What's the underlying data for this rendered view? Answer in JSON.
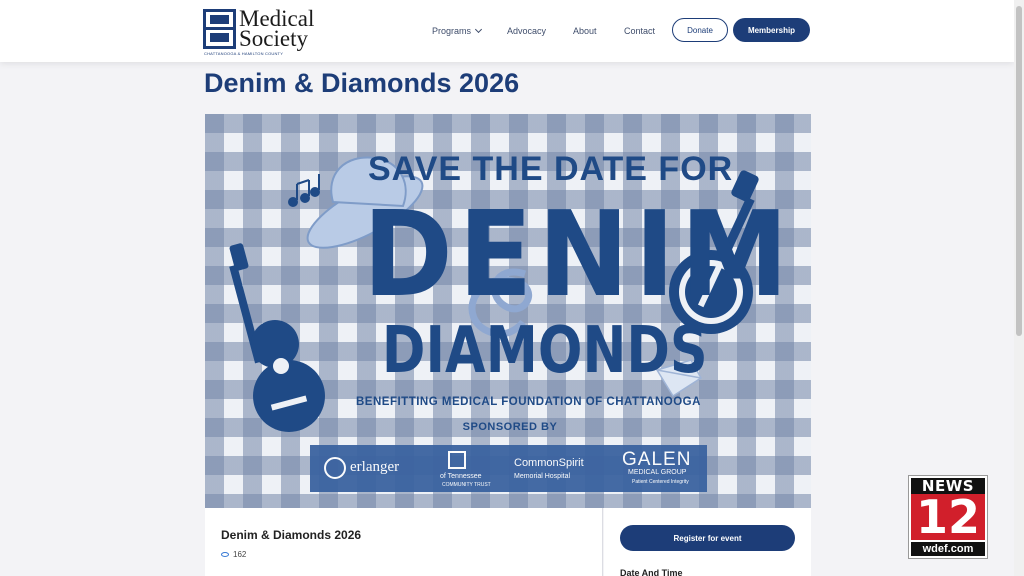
{
  "header": {
    "logo": {
      "line1": "Medical",
      "line2": "Society",
      "subtitle": "CHATTANOOGA & HAMILTON COUNTY"
    },
    "nav": {
      "programs": "Programs",
      "advocacy": "Advocacy",
      "about": "About",
      "contact": "Contact"
    },
    "donate_label": "Donate",
    "membership_label": "Membership"
  },
  "page": {
    "title": "Denim & Diamonds 2026"
  },
  "banner": {
    "save_the_date": "SAVE THE DATE FOR",
    "denim": "DENIM",
    "diamonds": "DIAMONDS",
    "benefitting": "BENEFITTING MEDICAL FOUNDATION OF CHATTANOOGA",
    "sponsored_by": "SPONSORED BY",
    "sponsors": {
      "erlanger": "erlanger",
      "bcbs_line1": "of Tennessee",
      "bcbs_line2": "COMMUNITY TRUST",
      "commonspirit_line1": "CommonSpirit",
      "commonspirit_line2": "Memorial Hospital",
      "galen_line1": "GALEN",
      "galen_line2": "MEDICAL GROUP",
      "galen_line3": "Patient Centered Integrity"
    }
  },
  "event_card": {
    "title": "Denim & Diamonds 2026",
    "views": "162",
    "register_label": "Register for event",
    "date_time_label": "Date And Time"
  },
  "watermark": {
    "top": "NEWS",
    "number": "12",
    "bottom": "wdef.com"
  },
  "colors": {
    "brand_navy": "#1d3d78",
    "banner_blue": "#1f4a86",
    "news_red": "#d11f2b"
  }
}
